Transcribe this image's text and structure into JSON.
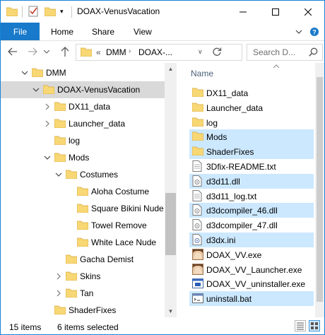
{
  "window": {
    "title": "DOAX-VenusVacation",
    "controls": {
      "minimize": "—",
      "maximize": "☐",
      "close": "✕"
    }
  },
  "ribbon": {
    "tabs": [
      {
        "label": "File",
        "active": true
      },
      {
        "label": "Home"
      },
      {
        "label": "Share"
      },
      {
        "label": "View"
      }
    ]
  },
  "address": {
    "overflow": "«",
    "crumbs": [
      "DMM",
      "DOAX-..."
    ],
    "search_placeholder": "Search D..."
  },
  "tree": [
    {
      "label": "DMM",
      "depth": 0,
      "expander": "expanded"
    },
    {
      "label": "DOAX-VenusVacation",
      "depth": 1,
      "expander": "expanded",
      "selected": true
    },
    {
      "label": "DX11_data",
      "depth": 2,
      "expander": "collapsed"
    },
    {
      "label": "Launcher_data",
      "depth": 2,
      "expander": "collapsed"
    },
    {
      "label": "log",
      "depth": 2,
      "expander": "none"
    },
    {
      "label": "Mods",
      "depth": 2,
      "expander": "expanded"
    },
    {
      "label": "Costumes",
      "depth": 3,
      "expander": "expanded"
    },
    {
      "label": "Aloha Costume",
      "depth": 4,
      "expander": "none"
    },
    {
      "label": "Square Bikini Nude",
      "depth": 4,
      "expander": "none"
    },
    {
      "label": "Towel Remove",
      "depth": 4,
      "expander": "none"
    },
    {
      "label": "White Lace Nude",
      "depth": 4,
      "expander": "none"
    },
    {
      "label": "Gacha Demist",
      "depth": 3,
      "expander": "none"
    },
    {
      "label": "Skins",
      "depth": 3,
      "expander": "collapsed"
    },
    {
      "label": "Tan",
      "depth": 3,
      "expander": "collapsed"
    },
    {
      "label": "ShaderFixes",
      "depth": 2,
      "expander": "none"
    }
  ],
  "files": {
    "column_header": "Name",
    "items": [
      {
        "name": "DX11_data",
        "icon": "folder-icon",
        "selected": false
      },
      {
        "name": "Launcher_data",
        "icon": "folder-icon",
        "selected": false
      },
      {
        "name": "log",
        "icon": "folder-icon",
        "selected": false
      },
      {
        "name": "Mods",
        "icon": "folder-icon",
        "selected": true
      },
      {
        "name": "ShaderFixes",
        "icon": "folder-icon",
        "selected": true
      },
      {
        "name": "3Dfix-README.txt",
        "icon": "text-file-icon",
        "selected": false
      },
      {
        "name": "d3d11.dll",
        "icon": "dll-file-icon",
        "selected": true
      },
      {
        "name": "d3d11_log.txt",
        "icon": "text-file-icon",
        "selected": false
      },
      {
        "name": "d3dcompiler_46.dll",
        "icon": "dll-file-icon",
        "selected": true
      },
      {
        "name": "d3dcompiler_47.dll",
        "icon": "dll-file-icon",
        "selected": false
      },
      {
        "name": "d3dx.ini",
        "icon": "ini-file-icon",
        "selected": true
      },
      {
        "name": "DOAX_VV.exe",
        "icon": "game-exe-icon",
        "selected": false
      },
      {
        "name": "DOAX_VV_Launcher.exe",
        "icon": "game-exe-icon",
        "selected": false
      },
      {
        "name": "DOAX_VV_uninstaller.exe",
        "icon": "installer-exe-icon",
        "selected": false
      },
      {
        "name": "uninstall.bat",
        "icon": "bat-file-icon",
        "selected": true
      }
    ]
  },
  "status": {
    "item_count": "15 items",
    "selection": "6 items selected"
  },
  "colors": {
    "accent": "#1979ca",
    "folder": "#f8d775",
    "selection": "#cce8ff",
    "tree_selection": "#d9d9d9"
  }
}
